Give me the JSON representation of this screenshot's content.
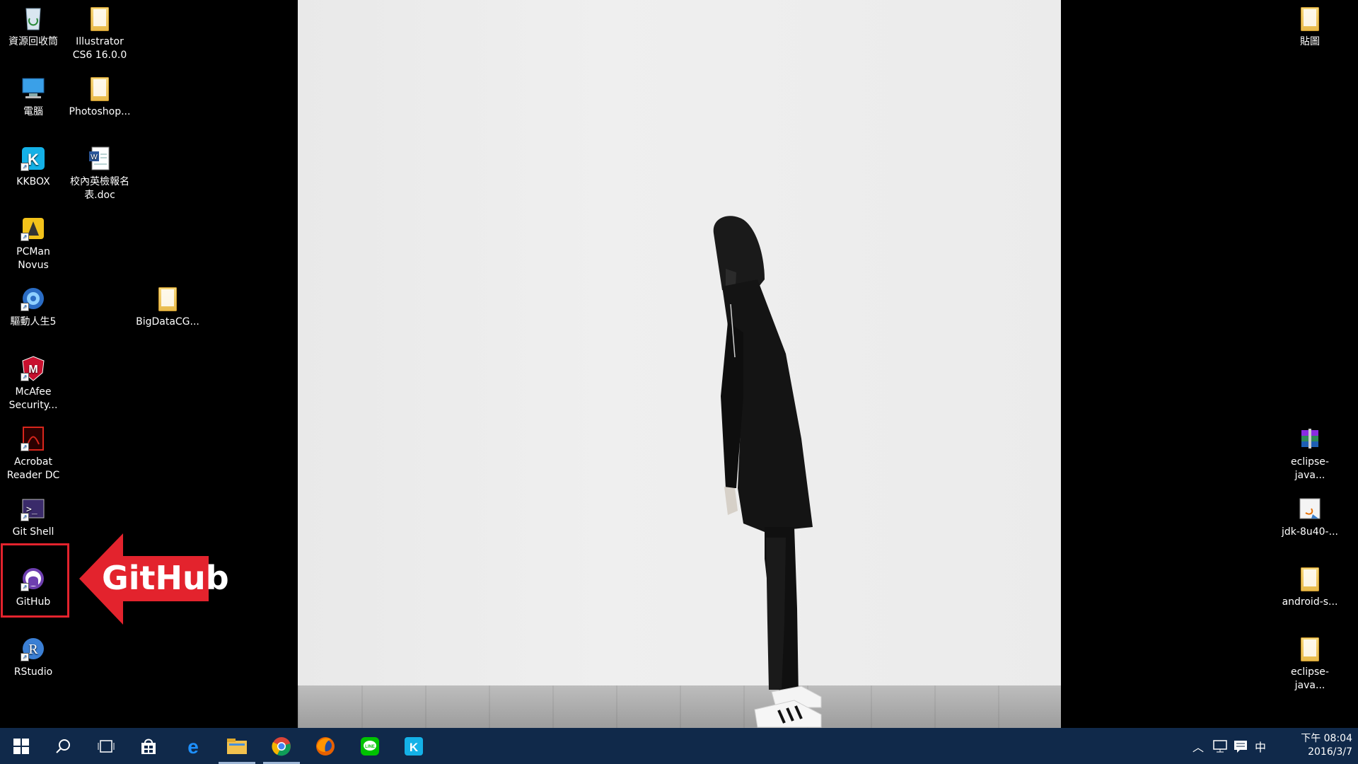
{
  "desktop": {
    "left_column": [
      {
        "label": "資源回收筒"
      },
      {
        "label": "電腦"
      },
      {
        "label": "KKBOX"
      },
      {
        "label": "PCMan Novus"
      },
      {
        "label": "驅動人生5"
      },
      {
        "label": "McAfee Security..."
      },
      {
        "label": "Acrobat Reader DC"
      },
      {
        "label": "Git Shell"
      },
      {
        "label": "GitHub"
      },
      {
        "label": "RStudio"
      }
    ],
    "second_column": [
      {
        "label": "Illustrator CS6 16.0.0"
      },
      {
        "label": "Photoshop..."
      },
      {
        "label": "校內英檢報名表.doc"
      }
    ],
    "misc": [
      {
        "label": "BigDataCG..."
      }
    ],
    "right_column": [
      {
        "label": "貼圖"
      },
      {
        "label": "eclipse-java..."
      },
      {
        "label": "jdk-8u40-..."
      },
      {
        "label": "android-s..."
      },
      {
        "label": "eclipse-java..."
      }
    ]
  },
  "annotation": {
    "callout_text": "GitHub",
    "color": "#e3232d"
  },
  "taskbar": {
    "apps": [
      "start-icon",
      "search-icon",
      "task-view-icon",
      "store-icon",
      "edge-icon",
      "file-explorer-icon",
      "chrome-icon",
      "firefox-icon",
      "line-icon",
      "kkbox-icon"
    ],
    "ime": "中",
    "clock_time": "下午 08:04",
    "clock_date": "2016/3/7"
  }
}
